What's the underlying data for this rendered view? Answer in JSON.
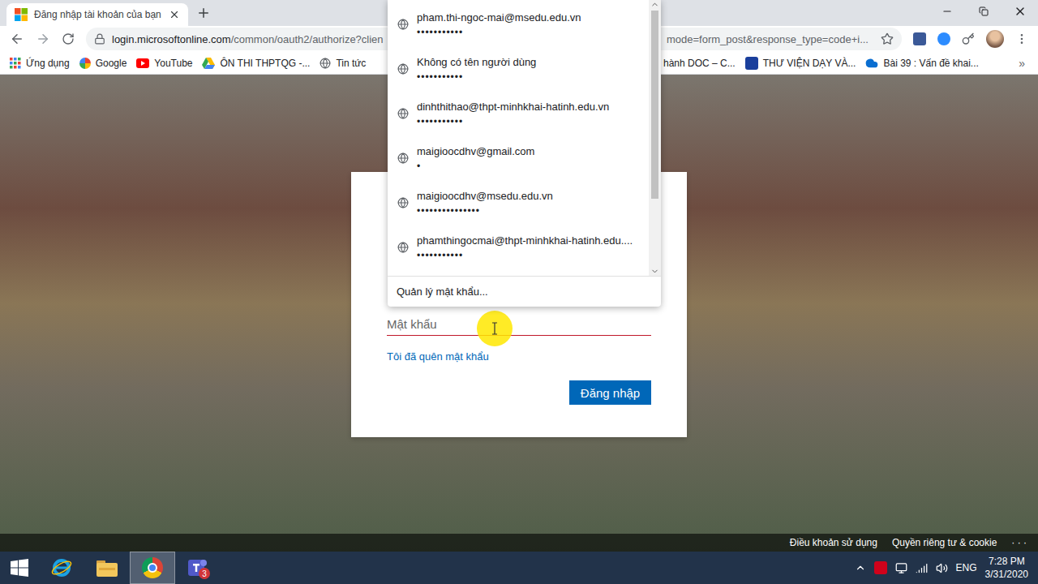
{
  "browser": {
    "tab": {
      "title": "Đăng nhập tài khoản của bạn",
      "selected": true
    },
    "url": {
      "host": "login.microsoftonline.com",
      "path": "/common/oauth2/authorize?clien",
      "tail": "mode=form_post&response_type=code+i..."
    },
    "bookmarks_left": [
      {
        "label": "Ứng dụng",
        "kind": "apps"
      },
      {
        "label": "Google",
        "kind": "google"
      },
      {
        "label": "YouTube",
        "kind": "youtube"
      },
      {
        "label": "ÔN THI THPTQG -...",
        "kind": "drive"
      },
      {
        "label": "Tin tức",
        "kind": "globe"
      }
    ],
    "bookmarks_right": [
      {
        "label": "hành DOC – C...",
        "kind": "none"
      },
      {
        "label": "THƯ VIỆN DẠY VÀ...",
        "kind": "site"
      },
      {
        "label": "Bài 39 : Vấn đề khai...",
        "kind": "onedrive"
      }
    ],
    "bookmarks_more": "»"
  },
  "password_menu": {
    "entries": [
      {
        "user": "pham.thi-ngoc-mai@msedu.edu.vn",
        "password": "•••••••••••"
      },
      {
        "user": "Không có tên người dùng",
        "password": "•••••••••••"
      },
      {
        "user": "dinhthithao@thpt-minhkhai-hatinh.edu.vn",
        "password": "•••••••••••"
      },
      {
        "user": "maigioocdhv@gmail.com",
        "password": "•"
      },
      {
        "user": "maigioocdhv@msedu.edu.vn",
        "password": "•••••••••••••••"
      },
      {
        "user": "phamthingocmai@thpt-minhkhai-hatinh.edu....",
        "password": "•••••••••••"
      }
    ],
    "manage": "Quản lý mật khẩu..."
  },
  "login": {
    "password_placeholder": "Mật khẩu",
    "password_focused": true,
    "forgot": "Tôi đã quên mật khẩu",
    "submit": "Đăng nhập"
  },
  "footer": {
    "links": [
      "Điều khoản sử dụng",
      "Quyền riêng tư & cookie",
      "· · ·"
    ]
  },
  "taskbar": {
    "apps": [
      {
        "kind": "ie",
        "selected": false,
        "badge": ""
      },
      {
        "kind": "explorer",
        "selected": false,
        "badge": ""
      },
      {
        "kind": "chrome",
        "selected": true,
        "badge": ""
      },
      {
        "kind": "teams",
        "selected": false,
        "badge": "3"
      }
    ],
    "tray": {
      "language": "ENG",
      "time": "7:28 PM",
      "date": "3/31/2020"
    }
  }
}
